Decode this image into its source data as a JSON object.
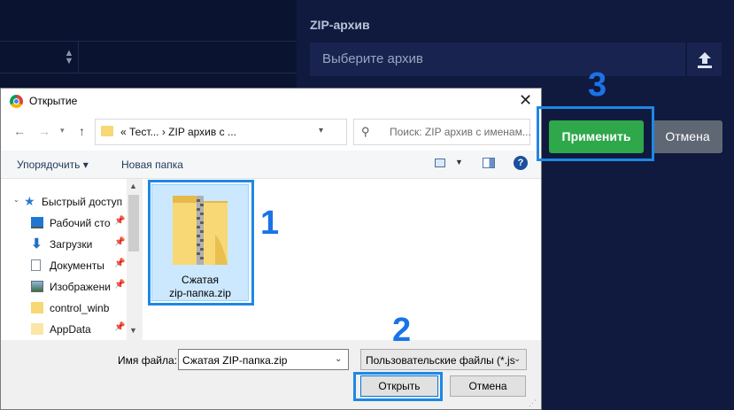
{
  "web": {
    "sort_arrows": "▲\n▼",
    "zip_label": "ZIP-архив",
    "zip_placeholder": "Выберите архив",
    "apply": "Применить",
    "cancel": "Отмена",
    "accent_green": "#2ea84a"
  },
  "dialog": {
    "title": "Открытие",
    "address": "«  Тест...  ›  ZIP архив с ...",
    "search_placeholder": "Поиск: ZIP архив с именам...",
    "organize": "Упорядочить ▾",
    "new_folder": "Новая папка",
    "nav": [
      {
        "label": "Быстрый доступ",
        "icon": "star-icon"
      },
      {
        "label": "Рабочий сто",
        "icon": "desktop-icon"
      },
      {
        "label": "Загрузки",
        "icon": "download-icon"
      },
      {
        "label": "Документы",
        "icon": "documents-icon"
      },
      {
        "label": "Изображени",
        "icon": "pictures-icon"
      },
      {
        "label": "control_winb",
        "icon": "folder-icon"
      },
      {
        "label": "AppData",
        "icon": "folder-icon"
      }
    ],
    "file": {
      "line1": "Сжатая",
      "line2": "zip-папка.zip"
    },
    "filename_label": "Имя файла:",
    "filename_value": "Сжатая ZIP-папка.zip",
    "filter": "Пользовательские файлы (*.js",
    "open": "Открыть",
    "cancel": "Отмена"
  },
  "callouts": [
    "1",
    "2",
    "3"
  ],
  "callout_color": "#1e88e5"
}
